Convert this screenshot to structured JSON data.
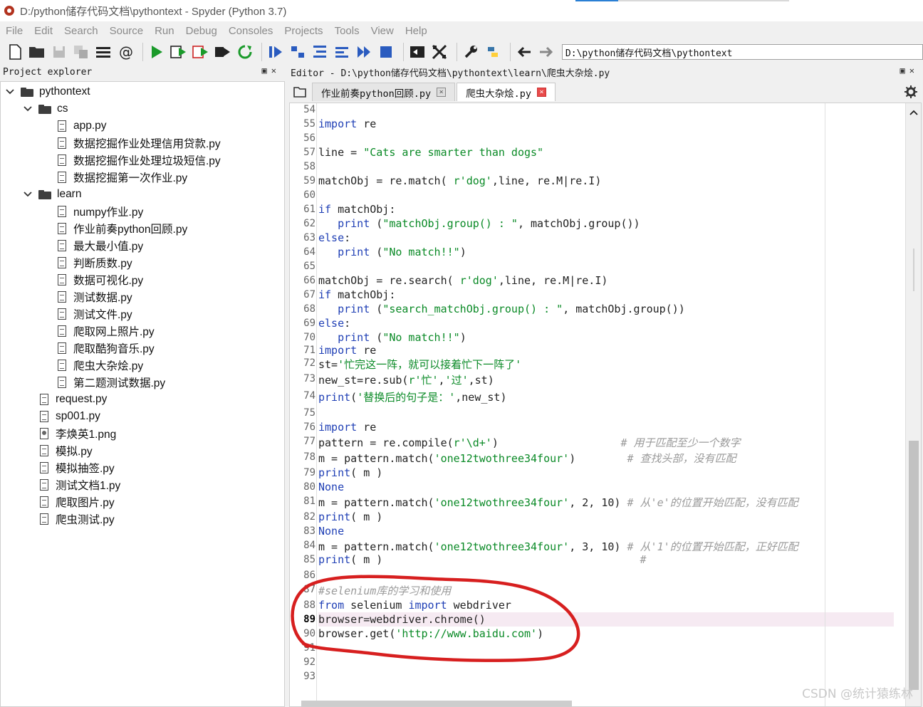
{
  "window": {
    "title": "D:/python储存代码文档\\pythontext - Spyder (Python 3.7)"
  },
  "menu": [
    "File",
    "Edit",
    "Search",
    "Source",
    "Run",
    "Debug",
    "Consoles",
    "Projects",
    "Tools",
    "View",
    "Help"
  ],
  "toolbar": {
    "path": "D:\\python储存代码文档\\pythontext"
  },
  "explorer": {
    "title": "Project explorer",
    "items": [
      {
        "label": "pythontext",
        "type": "folder",
        "level": 0
      },
      {
        "label": "cs",
        "type": "folder",
        "level": 1
      },
      {
        "label": "app.py",
        "type": "file",
        "level": 2
      },
      {
        "label": "数据挖掘作业处理信用贷款.py",
        "type": "file",
        "level": 2
      },
      {
        "label": "数据挖掘作业处理垃圾短信.py",
        "type": "file",
        "level": 2
      },
      {
        "label": "数据挖掘第一次作业.py",
        "type": "file",
        "level": 2
      },
      {
        "label": "learn",
        "type": "folder",
        "level": 1
      },
      {
        "label": "numpy作业.py",
        "type": "file",
        "level": 2
      },
      {
        "label": "作业前奏python回顾.py",
        "type": "file",
        "level": 2
      },
      {
        "label": "最大最小值.py",
        "type": "file",
        "level": 2
      },
      {
        "label": "判断质数.py",
        "type": "file",
        "level": 2
      },
      {
        "label": "数据可视化.py",
        "type": "file",
        "level": 2
      },
      {
        "label": "测试数据.py",
        "type": "file",
        "level": 2
      },
      {
        "label": "测试文件.py",
        "type": "file",
        "level": 2
      },
      {
        "label": "爬取网上照片.py",
        "type": "file",
        "level": 2
      },
      {
        "label": "爬取酷狗音乐.py",
        "type": "file",
        "level": 2
      },
      {
        "label": "爬虫大杂烩.py",
        "type": "file",
        "level": 2
      },
      {
        "label": "第二题测试数据.py",
        "type": "file",
        "level": 2
      },
      {
        "label": "request.py",
        "type": "file",
        "level": 1
      },
      {
        "label": "sp001.py",
        "type": "file",
        "level": 1
      },
      {
        "label": "李焕英1.png",
        "type": "image",
        "level": 1
      },
      {
        "label": "模拟.py",
        "type": "file",
        "level": 1
      },
      {
        "label": "模拟抽签.py",
        "type": "file",
        "level": 1
      },
      {
        "label": "测试文档1.py",
        "type": "file",
        "level": 1
      },
      {
        "label": "爬取图片.py",
        "type": "file",
        "level": 1
      },
      {
        "label": "爬虫测试.py",
        "type": "file",
        "level": 1
      }
    ]
  },
  "editor": {
    "title": "Editor - D:\\python储存代码文档\\pythontext\\learn\\爬虫大杂烩.py",
    "tabs": [
      {
        "label": "作业前奏python回顾.py",
        "active": false
      },
      {
        "label": "爬虫大杂烩.py",
        "active": true
      }
    ],
    "current_line": "89",
    "lines": [
      {
        "n": "54",
        "code": ""
      },
      {
        "n": "55",
        "code": "import re"
      },
      {
        "n": "56",
        "code": ""
      },
      {
        "n": "57",
        "code": "line = \"Cats are smarter than dogs\""
      },
      {
        "n": "58",
        "code": ""
      },
      {
        "n": "59",
        "code": "matchObj = re.match( r'dog',line, re.M|re.I)"
      },
      {
        "n": "60",
        "code": ""
      },
      {
        "n": "61",
        "code": "if matchObj:"
      },
      {
        "n": "62",
        "code": "   print (\"matchObj.group() : \", matchObj.group())"
      },
      {
        "n": "63",
        "code": "else:"
      },
      {
        "n": "64",
        "code": "   print (\"No match!!\")"
      },
      {
        "n": "65",
        "code": ""
      },
      {
        "n": "66",
        "code": "matchObj = re.search( r'dog',line, re.M|re.I)"
      },
      {
        "n": "67",
        "code": "if matchObj:"
      },
      {
        "n": "68",
        "code": "   print (\"search_matchObj.group() : \", matchObj.group())"
      },
      {
        "n": "69",
        "code": "else:"
      },
      {
        "n": "70",
        "code": "   print (\"No match!!\")"
      },
      {
        "n": "71",
        "code": "import re"
      },
      {
        "n": "72",
        "code": "st='忙完这一阵，就可以接着忙下一阵了'"
      },
      {
        "n": "73",
        "code": "new_st=re.sub(r'忙','过',st)"
      },
      {
        "n": "74",
        "code": "print('替换后的句子是：',new_st)"
      },
      {
        "n": "75",
        "code": ""
      },
      {
        "n": "76",
        "code": "import re"
      },
      {
        "n": "77",
        "code": "pattern = re.compile(r'\\d+')                   # 用于匹配至少一个数字"
      },
      {
        "n": "78",
        "code": "m = pattern.match('one12twothree34four')        # 查找头部，没有匹配"
      },
      {
        "n": "79",
        "code": "print( m )"
      },
      {
        "n": "80",
        "code": "None"
      },
      {
        "n": "81",
        "code": "m = pattern.match('one12twothree34four', 2, 10) # 从'e'的位置开始匹配，没有匹配"
      },
      {
        "n": "82",
        "code": "print( m )"
      },
      {
        "n": "83",
        "code": "None"
      },
      {
        "n": "84",
        "code": "m = pattern.match('one12twothree34four', 3, 10) # 从'1'的位置开始匹配，正好匹配"
      },
      {
        "n": "85",
        "code": "print( m )                                        #"
      },
      {
        "n": "86",
        "code": ""
      },
      {
        "n": "87",
        "code": "#selenium库的学习和使用"
      },
      {
        "n": "88",
        "code": "from selenium import webdriver"
      },
      {
        "n": "89",
        "code": "browser=webdriver.chrome()"
      },
      {
        "n": "90",
        "code": "browser.get('http://www.baidu.com')"
      },
      {
        "n": "91",
        "code": ""
      },
      {
        "n": "92",
        "code": ""
      },
      {
        "n": "93",
        "code": ""
      }
    ]
  },
  "watermark": "CSDN @统计猿练林",
  "colors": {
    "keyword": "#1f3fb5",
    "string": "#0a8a26",
    "comment": "#9a9a9a",
    "annotation": "#d71f1f"
  }
}
